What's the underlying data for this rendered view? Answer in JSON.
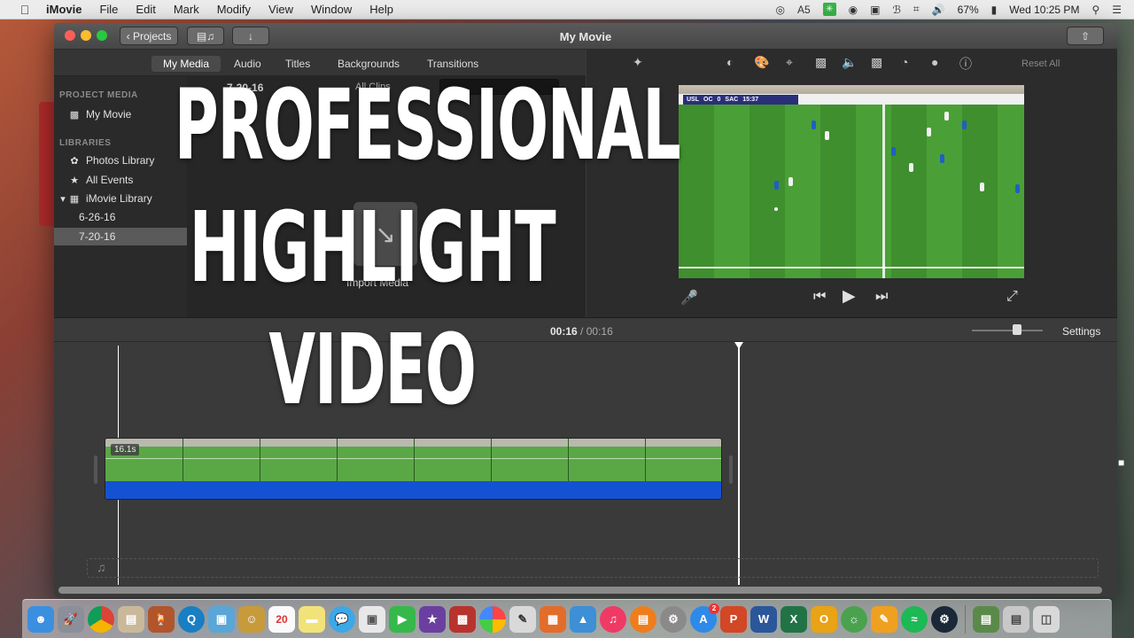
{
  "menubar": {
    "app_name": "iMovie",
    "items": [
      "File",
      "Edit",
      "Mark",
      "Modify",
      "View",
      "Window",
      "Help"
    ],
    "adobe_badge": "5",
    "battery": "67%",
    "clock": "Wed 10:25 PM"
  },
  "window": {
    "title": "My Movie",
    "projects_button": "Projects"
  },
  "browser": {
    "tabs": [
      "My Media",
      "Audio",
      "Titles",
      "Backgrounds",
      "Transitions"
    ],
    "sidebar": {
      "project_header": "PROJECT MEDIA",
      "project_item": "My Movie",
      "libraries_header": "LIBRARIES",
      "photos_library": "Photos Library",
      "all_events": "All Events",
      "imovie_library": "iMovie Library",
      "event_1": "6-26-16",
      "event_2": "7-20-16"
    },
    "media": {
      "date_header": "7-20-16",
      "option_text": "All Clips",
      "import_label": "Import Media"
    }
  },
  "viewer": {
    "reset_all": "Reset All",
    "scoreboard": [
      "USL",
      "OC",
      "0",
      "SAC",
      "15:37"
    ]
  },
  "timeline": {
    "current_time": "00:16",
    "separator": "/",
    "total_time": "00:16",
    "settings_label": "Settings",
    "clip_duration": "16.1s"
  },
  "overlay": {
    "line1": "PROFESSIONAL",
    "line2": "HIGHLIGHT",
    "line3": "VIDEO"
  },
  "icons": {
    "apple": "apple-icon",
    "wand": "magic-wand-icon",
    "dock": [
      "finder",
      "launchpad",
      "chrome",
      "notes",
      "photo-booth",
      "quicktime",
      "preview",
      "contacts",
      "calendar",
      "stickies",
      "messages",
      "photos",
      "facetime",
      "imovie",
      "photo-booth-2",
      "photos-2",
      "keynote",
      "pages",
      "numbers",
      "keynote-2",
      "itunes",
      "ibooks",
      "system-preferences",
      "app-store",
      "powerpoint",
      "word",
      "excel",
      "outlook",
      "migration",
      "pages-2",
      "spotify",
      "steam",
      "screenshots",
      "downloads",
      "trash"
    ]
  },
  "dock_labels": {
    "calendar_day": "20",
    "appstore_badge": "2"
  }
}
